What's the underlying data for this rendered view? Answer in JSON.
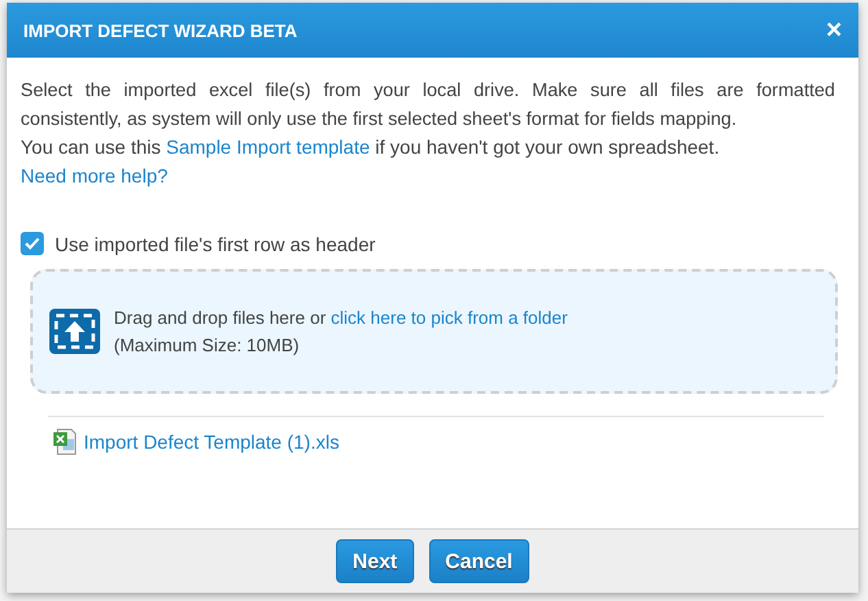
{
  "dialog": {
    "title": "IMPORT DEFECT WIZARD BETA",
    "close": "×"
  },
  "intro": "Select the imported excel file(s) from your local drive. Make sure all files are formatted consistently, as system will only use the first selected sheet's format for fields mapping.",
  "template_line": {
    "before": "You can use this ",
    "link": "Sample Import template",
    "after": " if you haven't got your own spreadsheet."
  },
  "help_link": "Need more help?",
  "header_option": {
    "label": "Use imported file's first row as header",
    "checked": true
  },
  "dropzone": {
    "text": "Drag and drop files here or ",
    "link": "click here to pick from a folder",
    "limit": "(Maximum Size: 10MB)"
  },
  "files": [
    {
      "name": "Import Defect Template (1).xls"
    }
  ],
  "buttons": [
    "Next",
    "Cancel"
  ]
}
